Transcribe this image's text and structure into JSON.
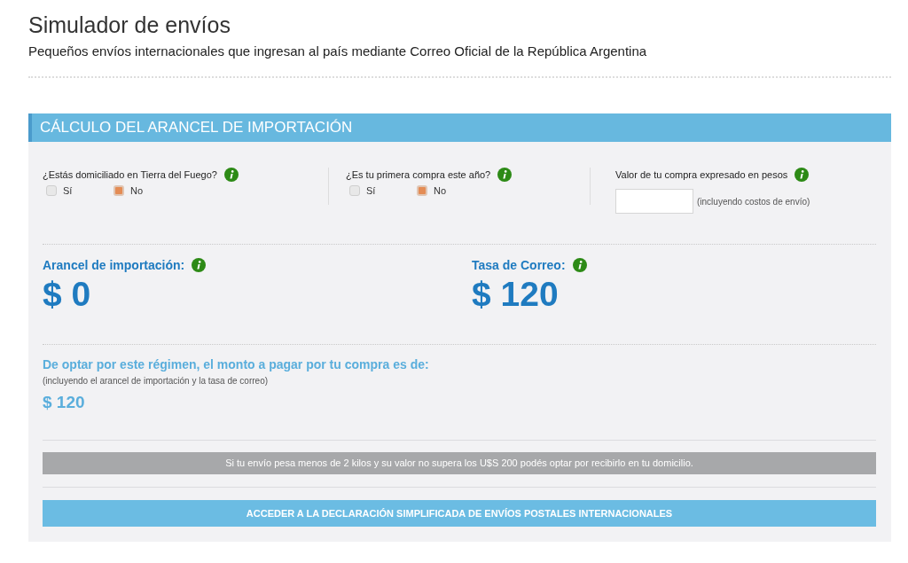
{
  "header": {
    "title": "Simulador de envíos",
    "subtitle": "Pequeños envíos internacionales que ingresan al país mediante Correo Oficial de la República Argentina"
  },
  "calculator": {
    "title": "CÁLCULO DEL ARANCEL DE IMPORTACIÓN",
    "questions": [
      {
        "kind": "choice",
        "label": "¿Estás domiciliado en Tierra del Fuego?",
        "options": [
          {
            "label": "Sí",
            "selected": false
          },
          {
            "label": "No",
            "selected": true
          }
        ]
      },
      {
        "kind": "choice",
        "label": "¿Es tu primera compra este año?",
        "options": [
          {
            "label": "Sí",
            "selected": false
          },
          {
            "label": "No",
            "selected": true
          }
        ]
      },
      {
        "kind": "amount",
        "label": "Valor de tu compra expresado en pesos",
        "note": "(incluyendo costos de envío)"
      }
    ],
    "results": [
      {
        "label": "Arancel de importación:",
        "amount": "$ 0"
      },
      {
        "label": "Tasa de Correo:",
        "amount": "$ 120"
      }
    ],
    "total": {
      "label": "De optar por este régimen, el monto a pagar por tu compra es de:",
      "note": "(incluyendo el arancel de importación y la tasa de correo)",
      "amount": "$ 120"
    },
    "notice": "Si tu envío pesa menos de 2 kilos y su valor no supera los U$S 200 podés optar por recibirlo en tu domicilio.",
    "action_button": "ACCEDER A LA DECLARACIÓN SIMPLIFICADA DE ENVÍOS POSTALES INTERNACIONALES"
  }
}
